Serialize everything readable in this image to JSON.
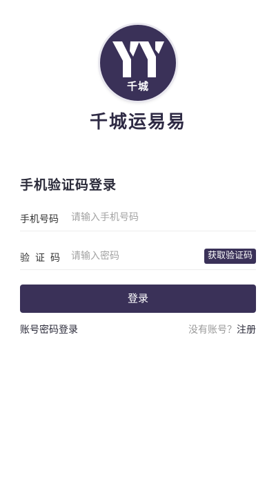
{
  "logo": {
    "text": "千城",
    "letters": "YY",
    "background_color": "#3a3158"
  },
  "app": {
    "name": "千城运易易"
  },
  "form": {
    "title": "手机验证码登录",
    "phone": {
      "label": "手机号码",
      "placeholder": "请输入手机号码",
      "value": ""
    },
    "code": {
      "label": "验证码",
      "placeholder": "请输入密码",
      "value": "",
      "get_code_label": "获取验证码"
    },
    "login_label": "登录",
    "alt_login_label": "账号密码登录",
    "no_account_text": "没有账号？",
    "register_label": "注册"
  },
  "colors": {
    "accent": "#3a3158",
    "placeholder": "#a3a3a3",
    "muted_text": "#9a9a9a"
  }
}
